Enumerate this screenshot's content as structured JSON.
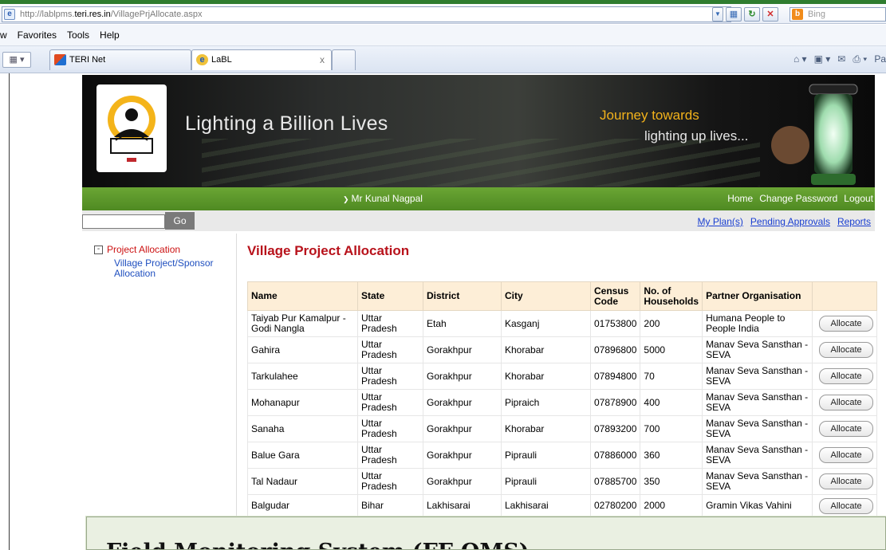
{
  "browser": {
    "url_prefix": "http://lablpms.",
    "url_domain": "teri.res.in",
    "url_path": "/VillagePrjAllocate.aspx",
    "search_placeholder": "Bing",
    "menu": [
      "w",
      "Favorites",
      "Tools",
      "Help"
    ],
    "tabs": [
      {
        "label": "TERI Net",
        "icon": "teri-net-icon"
      },
      {
        "label": "LaBL",
        "icon": "ie-page-icon",
        "close": "x"
      }
    ],
    "command_icons": [
      "home-icon",
      "feeds-icon",
      "read-mail-icon",
      "print-icon"
    ],
    "cut_off_label": "Pa"
  },
  "banner": {
    "title": "Lighting a Billion Lives",
    "tagline_line1": "Journey towards",
    "tagline_line2": "lighting up lives..."
  },
  "header": {
    "user_label": "Mr Kunal Nagpal",
    "links": [
      "Home",
      "Change Password",
      "Logout"
    ]
  },
  "subbar": {
    "go_label": "Go",
    "links": [
      "My Plan(s)",
      "Pending Approvals",
      "Reports"
    ]
  },
  "sidenav": {
    "toggle": "-",
    "root_label": "Project Allocation",
    "child_label": "Village Project/Sponsor Allocation"
  },
  "main": {
    "heading": "Village Project Allocation",
    "columns": [
      "Name",
      "State",
      "District",
      "City",
      "Census Code",
      "No. of Households",
      "Partner Organisation",
      ""
    ],
    "action_label": "Allocate",
    "rows": [
      [
        "Taiyab Pur Kamalpur - Godi Nangla",
        "Uttar Pradesh",
        "Etah",
        "Kasganj",
        "01753800",
        "200",
        "Humana People to People India"
      ],
      [
        "Gahira",
        "Uttar Pradesh",
        "Gorakhpur",
        "Khorabar",
        "07896800",
        "5000",
        "Manav Seva Sansthan - SEVA"
      ],
      [
        "Tarkulahee",
        "Uttar Pradesh",
        "Gorakhpur",
        "Khorabar",
        "07894800",
        "70",
        "Manav Seva Sansthan - SEVA"
      ],
      [
        "Mohanapur",
        "Uttar Pradesh",
        "Gorakhpur",
        "Pipraich",
        "07878900",
        "400",
        "Manav Seva Sansthan - SEVA"
      ],
      [
        "Sanaha",
        "Uttar Pradesh",
        "Gorakhpur",
        "Khorabar",
        "07893200",
        "700",
        "Manav Seva Sansthan - SEVA"
      ],
      [
        "Balue Gara",
        "Uttar Pradesh",
        "Gorakhpur",
        "Piprauli",
        "07886000",
        "360",
        "Manav Seva Sansthan - SEVA"
      ],
      [
        "Tal Nadaur",
        "Uttar Pradesh",
        "Gorakhpur",
        "Piprauli",
        "07885700",
        "350",
        "Manav Seva Sansthan - SEVA"
      ],
      [
        "Balgudar",
        "Bihar",
        "Lakhisarai",
        "Lakhisarai",
        "02780200",
        "2000",
        "Gramin Vikas Vahini"
      ]
    ]
  },
  "overlay": {
    "title": "Field Monitoring System (FF-OMS)"
  },
  "colors": {
    "brand_green": "#5a9629",
    "heading_red": "#b8121b",
    "link_blue": "#1a3fd1",
    "tagline_gold": "#f2b21b",
    "table_header_bg": "#fdeed7"
  }
}
